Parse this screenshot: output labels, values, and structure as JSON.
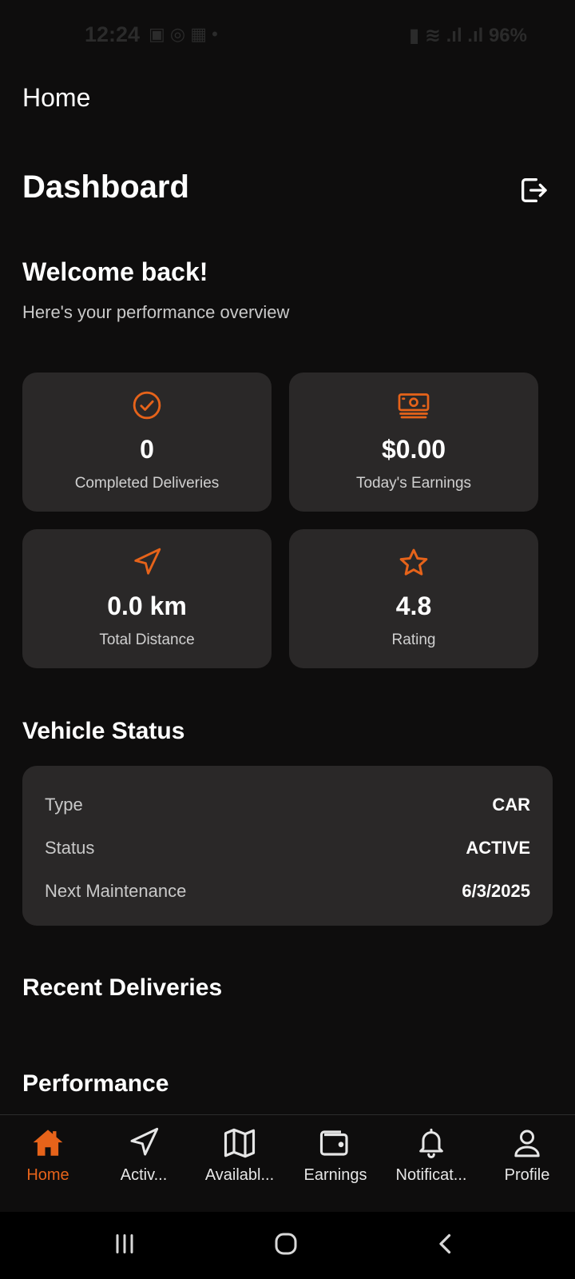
{
  "status_bar": {
    "time": "12:24",
    "battery": "96%"
  },
  "header": {
    "home_title": "Home",
    "dashboard_title": "Dashboard"
  },
  "welcome": {
    "title": "Welcome back!",
    "subtitle": "Here's your performance overview"
  },
  "stats": [
    {
      "value": "0",
      "label": "Completed Deliveries",
      "icon": "check-circle-icon"
    },
    {
      "value": "$0.00",
      "label": "Today's Earnings",
      "icon": "cash-icon"
    },
    {
      "value": "0.0 km",
      "label": "Total Distance",
      "icon": "navigation-arrow-icon"
    },
    {
      "value": "4.8",
      "label": "Rating",
      "icon": "star-icon"
    }
  ],
  "vehicle": {
    "section_title": "Vehicle Status",
    "rows": [
      {
        "key": "Type",
        "value": "CAR"
      },
      {
        "key": "Status",
        "value": "ACTIVE"
      },
      {
        "key": "Next Maintenance",
        "value": "6/3/2025"
      }
    ]
  },
  "sections": {
    "recent": "Recent Deliveries",
    "performance": "Performance"
  },
  "nav": {
    "items": [
      {
        "label": "Home",
        "icon": "home-icon",
        "active": true
      },
      {
        "label": "Activ...",
        "icon": "navigation-icon"
      },
      {
        "label": "Availabl...",
        "icon": "map-icon"
      },
      {
        "label": "Earnings",
        "icon": "wallet-icon"
      },
      {
        "label": "Notificat...",
        "icon": "bell-icon"
      },
      {
        "label": "Profile",
        "icon": "user-icon"
      }
    ]
  },
  "colors": {
    "accent": "#e6631a",
    "background": "#0e0d0d",
    "card": "#2a2828"
  }
}
